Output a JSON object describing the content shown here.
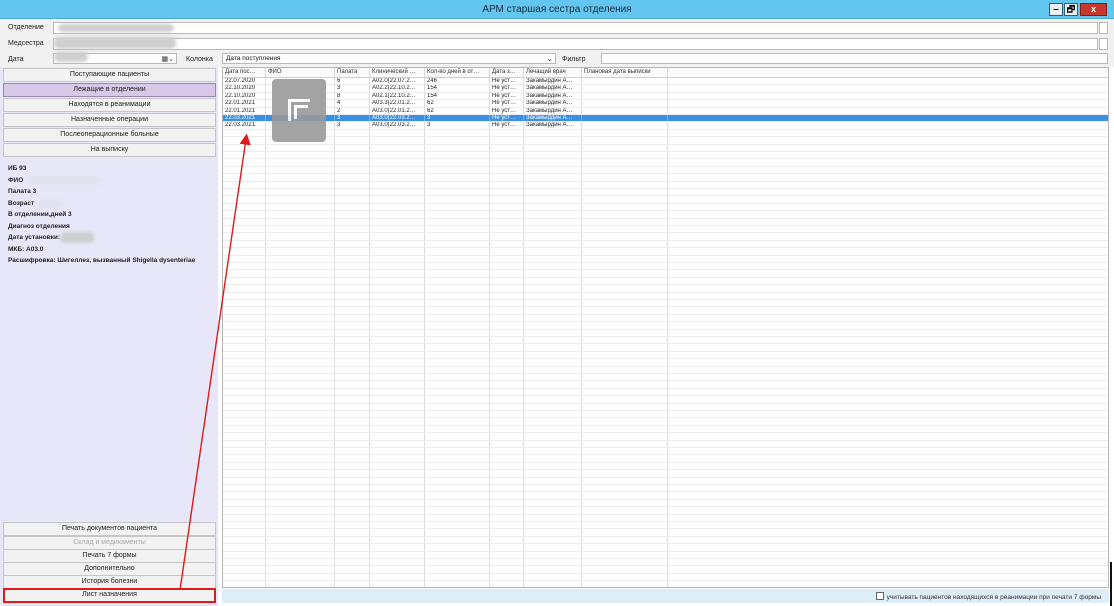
{
  "window": {
    "title": "АРМ старшая сестра отделения",
    "controls": {
      "minimize": "‒",
      "maximize": "🗗",
      "close": "x"
    }
  },
  "form": {
    "department_label": "Отделение",
    "nurse_label": "Медсестра",
    "date_label": "Дата",
    "column_label": "Колонка",
    "column_value": "Дата поступления",
    "filter_label": "Фильтр",
    "filter_value": ""
  },
  "nav": {
    "top": [
      "Поступающие пациенты",
      "Лежащие в отделении",
      "Находятся в реанимации",
      "Назначенные операции",
      "Послеоперационные больные",
      "На выписку"
    ],
    "bottom": [
      "Печать документов пациента",
      "Склад и медикаменты",
      "Печать 7 формы",
      "Дополнительно",
      "История болезни",
      "Лист назначения"
    ]
  },
  "patient_info": {
    "ib": "ИБ 93",
    "fio_label": "ФИО",
    "ward": "Палата 3",
    "age_label": "Возраст",
    "days": "В отделении,дней 3",
    "diagnosis": "Диагноз отделения",
    "install_date_label": "Дата установки:",
    "mkb": "МКБ: A03.0",
    "decoding": "Расшифровка: Шигеллез, вызванный Shigella dysenteriae"
  },
  "table": {
    "headers": [
      "Дата пос…",
      "ФИО",
      "Палата",
      "Клинический …",
      "Кол-во дней в от…",
      "Дата з…",
      "Лечащий врач",
      "Плановая дата выписки"
    ],
    "rows": [
      [
        "22.07.2020",
        "",
        "6",
        "A02.0(22.07.2…",
        "246",
        "Не уст…",
        "Закамырдин А…",
        ""
      ],
      [
        "22.10.2020",
        "",
        "3",
        "A02.2(22.10.2…",
        "154",
        "Не уст…",
        "Закамырдин А…",
        ""
      ],
      [
        "22.10.2020",
        "",
        "8",
        "A02.1(22.10.2…",
        "154",
        "Не уст…",
        "Закамырдин А…",
        ""
      ],
      [
        "22.01.2021",
        "",
        "4",
        "A03.3(22.01.2…",
        "62",
        "Не уст…",
        "Закамырдин А…",
        ""
      ],
      [
        "22.01.2021",
        "",
        "2",
        "A03.0(22.01.2…",
        "62",
        "Не уст…",
        "Закамырдин А…",
        ""
      ],
      [
        "22.03.2021",
        "",
        "3",
        "A03.0(22.03.2…",
        "3",
        "Не уст…",
        "Закамырдин А…",
        ""
      ],
      [
        "22.03.2021",
        "",
        "3",
        "A03.0(22.03.2…",
        "3",
        "Не уст…",
        "Закамырдин А…",
        ""
      ]
    ]
  },
  "footer": {
    "checkbox_label": "учитывать пациентов находящихся в реанимации при печати 7 формы"
  }
}
